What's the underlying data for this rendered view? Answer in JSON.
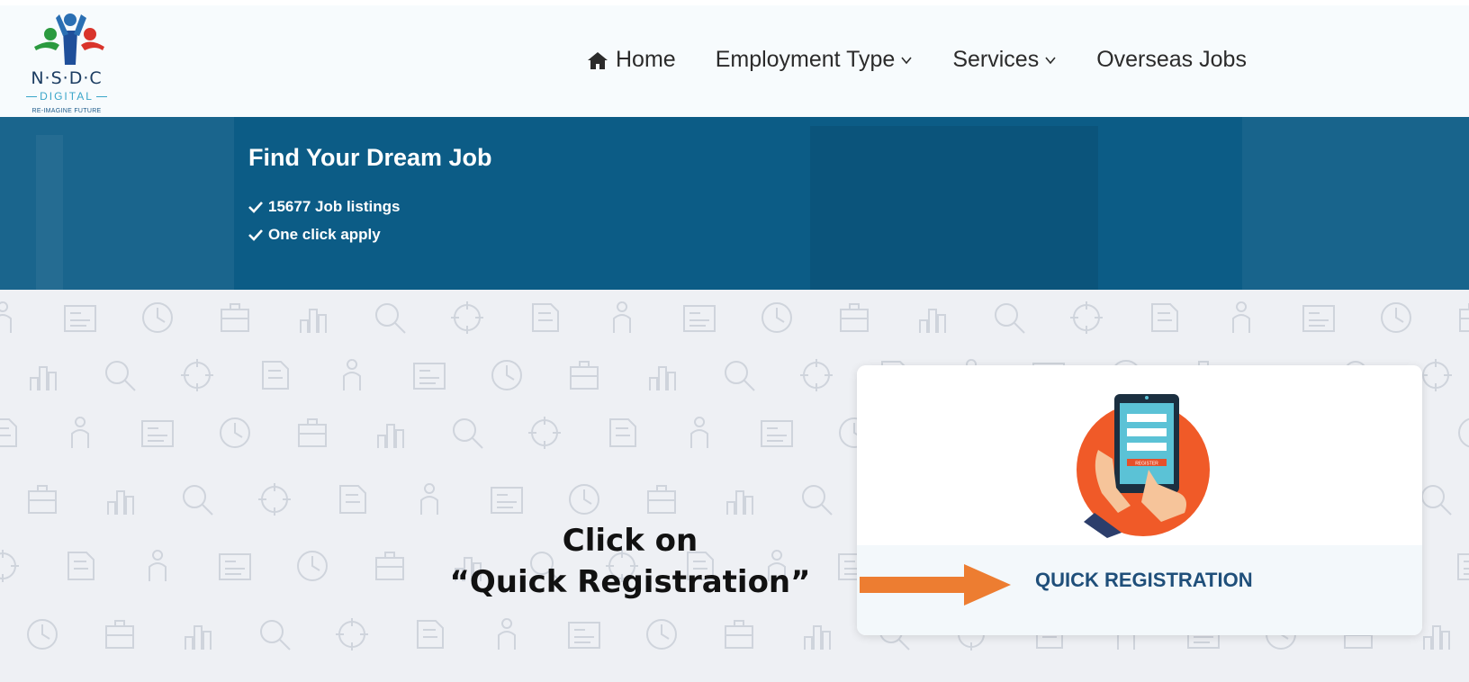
{
  "logo": {
    "name": "N·S·D·C",
    "sub": "DIGITAL",
    "tagline": "RE-IMAGINE FUTURE"
  },
  "nav": {
    "home": "Home",
    "employment_type": "Employment Type",
    "services": "Services",
    "overseas_jobs": "Overseas Jobs"
  },
  "banner": {
    "title": "Find Your Dream Job",
    "items": [
      "15677 Job listings",
      "One click apply"
    ]
  },
  "card": {
    "label": "QUICK REGISTRATION",
    "illustration_button": "REGISTER"
  },
  "callout": {
    "line1": "Click on",
    "line2": "“Quick Registration”"
  },
  "colors": {
    "banner": "#0c5c86",
    "card_label": "#1f4f7a",
    "arrow": "#ed7d31",
    "illustration_circle": "#f05a28"
  }
}
